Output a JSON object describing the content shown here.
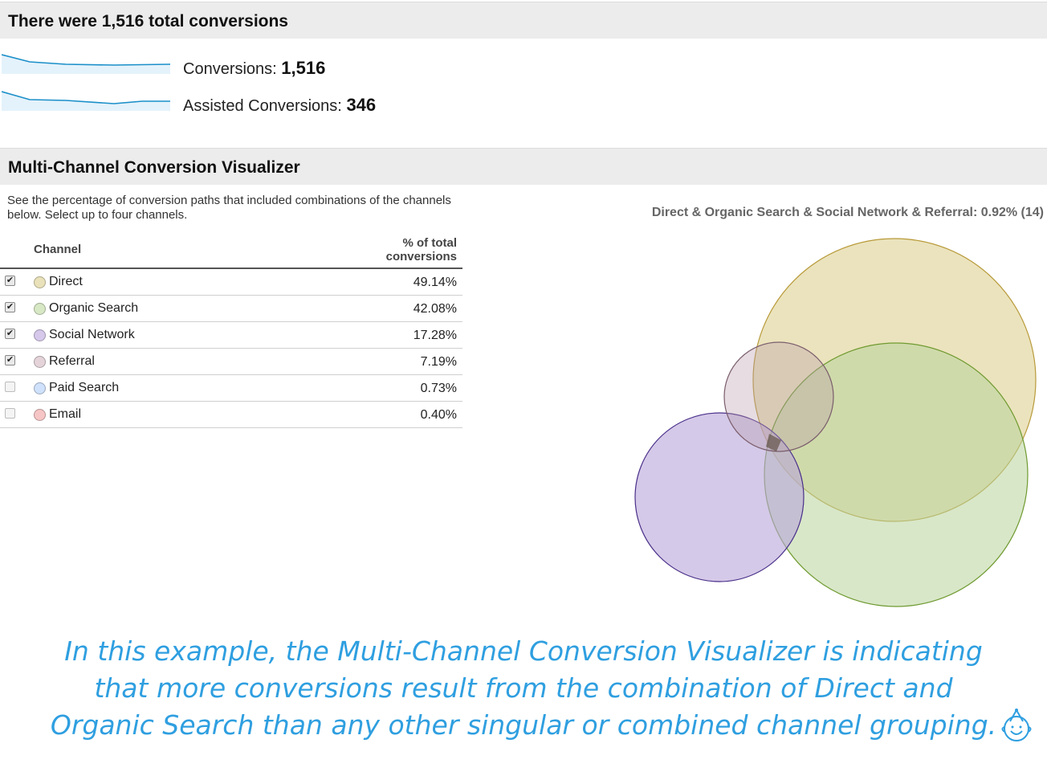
{
  "summary": {
    "title": "There were 1,516 total conversions",
    "conversions_label": "Conversions:",
    "conversions_value": "1,516",
    "assisted_label": "Assisted Conversions:",
    "assisted_value": "346",
    "spark_color": "#1a8fc9"
  },
  "visualizer": {
    "title": "Multi-Channel Conversion Visualizer",
    "description": "See the percentage of conversion paths that included combinations of the channels below. Select up to four channels.",
    "col_channel": "Channel",
    "col_pct": "% of total conversions",
    "channels": [
      {
        "name": "Direct",
        "pct": "49.14%",
        "checked": true,
        "color": "#e9e1b9"
      },
      {
        "name": "Organic Search",
        "pct": "42.08%",
        "checked": true,
        "color": "#d7e8c5"
      },
      {
        "name": "Social Network",
        "pct": "17.28%",
        "checked": true,
        "color": "#d5c8ea"
      },
      {
        "name": "Referral",
        "pct": "7.19%",
        "checked": true,
        "color": "#e4d4da"
      },
      {
        "name": "Paid Search",
        "pct": "0.73%",
        "checked": false,
        "color": "#cfe1fb"
      },
      {
        "name": "Email",
        "pct": "0.40%",
        "checked": false,
        "color": "#f6c5c5"
      }
    ],
    "venn_label": "Direct & Organic Search & Social Network & Referral: 0.92% (14)",
    "checkmark": "✔"
  },
  "caption": {
    "line1": "In this example, the Multi-Channel Conversion Visualizer is indicating",
    "line2": "that more conversions result from the combination of Direct and",
    "line3": "Organic Search than any other singular or combined channel grouping."
  },
  "logo_icon": "smiling-face-icon"
}
